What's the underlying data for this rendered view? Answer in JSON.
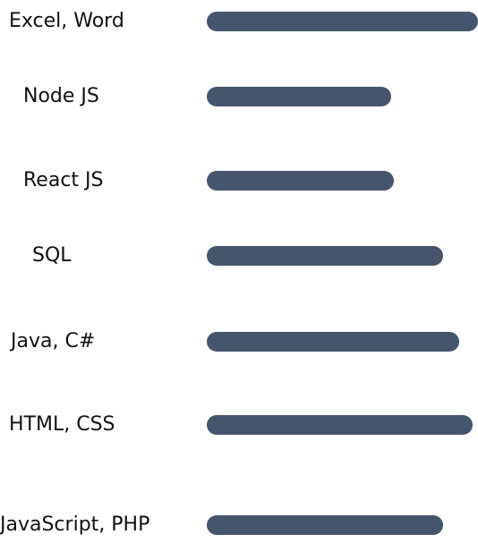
{
  "bar_color": "#46556e",
  "skills": [
    {
      "label": "Excel, Word",
      "level": 1.0
    },
    {
      "label": "Node JS",
      "level": 0.68
    },
    {
      "label": "React JS",
      "level": 0.69
    },
    {
      "label": "SQL",
      "level": 0.87
    },
    {
      "label": "Java, C#",
      "level": 0.93
    },
    {
      "label": "HTML, CSS",
      "level": 0.98
    },
    {
      "label": "JavaScript, PHP",
      "level": 0.87
    }
  ]
}
